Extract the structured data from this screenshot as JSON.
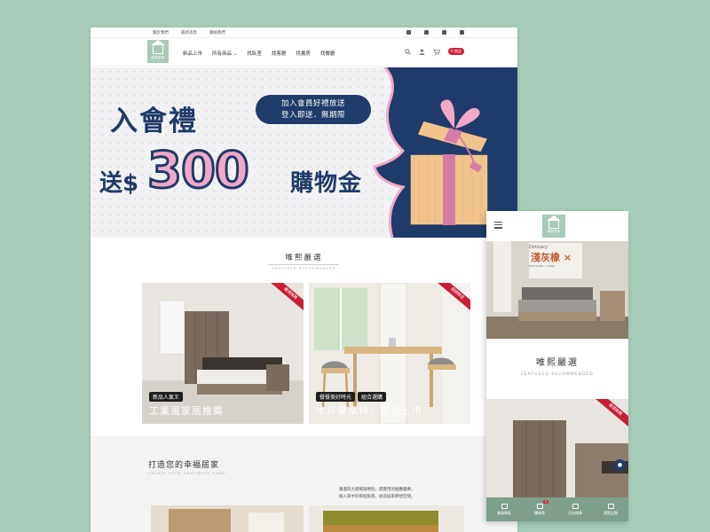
{
  "desktop": {
    "topbar_links": [
      "關於我們",
      "最新消息",
      "聯絡我們"
    ],
    "social_icons": [
      "facebook-icon",
      "instagram-icon",
      "line-icon",
      "youtube-icon"
    ],
    "logo_text": "唯熙居家",
    "nav": [
      "新品上市",
      "所有商品 ⌄",
      "找臥室",
      "找客廳",
      "找書房",
      "找餐廳"
    ],
    "cart_label": "0 商品",
    "hero": {
      "title": "入會禮",
      "pill_line1": "加入會員好禮放送",
      "pill_line2": "登入即送．無期限",
      "send": "送$",
      "amount": "300",
      "gift": "購物金"
    },
    "featured_title": "唯熙嚴選",
    "featured_sub": "FEATURED RECOMMENDED",
    "cards": [
      {
        "ribbon": "嚴選推薦",
        "tags": [
          "新品人氣王"
        ],
        "title": "工業風家居推薦"
      },
      {
        "ribbon": "期間限定",
        "tags": [
          "餐餐美好時光",
          "組合選購"
        ],
        "title": "木質餐桌椅．新品上市"
      }
    ],
    "home_title": "打造您的幸福居家",
    "home_sub": "CREATE YOUR HAPPINESS HOME",
    "home_desc_1": "嚴選四大最暢銷類別，最實用的推薦優惠，",
    "home_desc_2": "融入家中的每個角落，創造居家夢想空間。"
  },
  "mobile": {
    "logo_text": "唯熙居家",
    "banner_small": "Delicacy",
    "banner_title": "淺灰橡 ×",
    "banner_info": "NTD 0,000 ~ 0,000",
    "featured_title": "唯熙嚴選",
    "featured_sub": "FEATURED RECOMMENDED",
    "card_ribbon": "嚴選推薦",
    "tabbar": [
      "會員專區",
      "購物車",
      "全站搜尋",
      "瀏覽足跡"
    ],
    "cart_badge": "0"
  },
  "colors": {
    "background": "#a7cbb8",
    "navy": "#1f3b69",
    "pink": "#f3a8c8",
    "ribbon_red": "#c81f36",
    "tabbar_green": "#7f9f8d"
  }
}
